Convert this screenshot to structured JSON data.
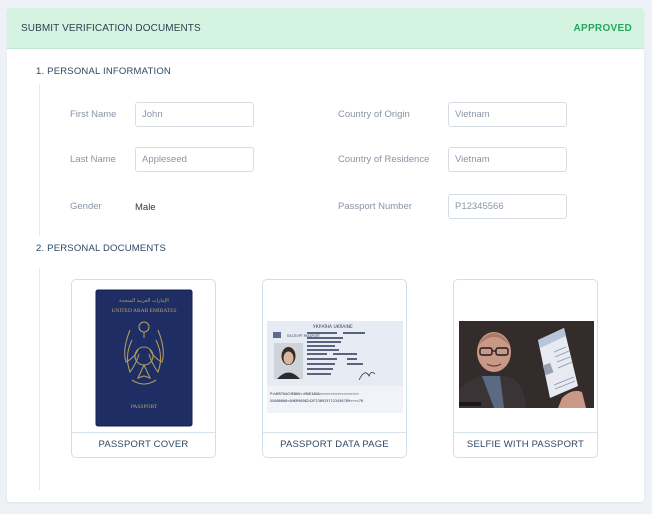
{
  "header": {
    "title": "SUBMIT VERIFICATION DOCUMENTS",
    "status": "APPROVED",
    "status_color": "#24a85b",
    "background": "#d4f3e1"
  },
  "personal_info": {
    "section_title": "1. PERSONAL INFORMATION",
    "fields": {
      "first_name": {
        "label": "First Name",
        "value": "John"
      },
      "last_name": {
        "label": "Last Name",
        "value": "Appleseed"
      },
      "gender": {
        "label": "Gender",
        "value": "Male"
      },
      "country_origin": {
        "label": "Country of Origin",
        "value": "Vietnam"
      },
      "country_residence": {
        "label": "Country of Residence",
        "value": "Vietnam"
      },
      "passport_number": {
        "label": "Passport Number",
        "value": "P12345566"
      }
    }
  },
  "documents": {
    "section_title": "2. PERSONAL DOCUMENTS",
    "items": [
      {
        "caption": "PASSPORT COVER",
        "image": "passport-cover-image"
      },
      {
        "caption": "PASSPORT DATA PAGE",
        "image": "passport-data-page-image"
      },
      {
        "caption": "SELFIE WITH PASSPORT",
        "image": "selfie-with-passport-image"
      }
    ],
    "cover_text": {
      "arabic": "الإمارات العربية المتحدة",
      "country": "UNITED ARAB EMIRATES",
      "word": "PASSPORT"
    },
    "data_page_text": {
      "country": "УКРАЇНА  UKRAINE",
      "doc": "ПАСПОРТ PASSPORT",
      "mrz1": "P<UKRTKACHENKO<<MARIANA<<<<<<<<<<<<<<<<<<",
      "mrz2": "XX000000<0UKR9608242F2309257123456789<<<<70"
    }
  }
}
